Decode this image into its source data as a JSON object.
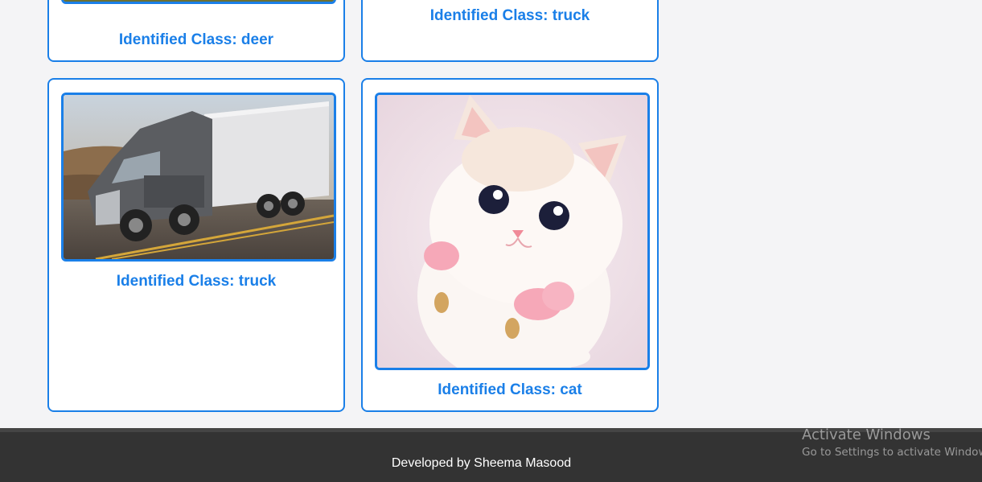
{
  "cards": [
    {
      "label": "Identified Class: deer",
      "image": "deer-photo"
    },
    {
      "label": "Identified Class: truck",
      "image": "truck-photo"
    },
    {
      "label": "Identified Class: truck",
      "image": "semi-truck-on-road-photo"
    },
    {
      "label": "Identified Class: cat",
      "image": "white-kitten-photo"
    }
  ],
  "footer": {
    "text": "Developed by Sheema Masood"
  },
  "windows_watermark": {
    "title": "Activate Windows",
    "subtitle": "Go to Settings to activate Windows."
  }
}
